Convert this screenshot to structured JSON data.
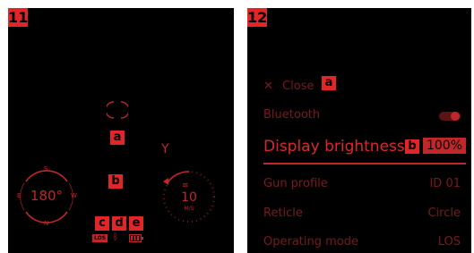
{
  "left_panel": {
    "number": "11",
    "label_a": "a",
    "label_b": "b",
    "label_c": "c",
    "label_d": "d",
    "label_e": "e",
    "y_marker": "Y",
    "compass": {
      "north": "N",
      "south": "S",
      "east": "E",
      "west": "W",
      "heading": "180°"
    },
    "wind": {
      "speed": "10",
      "unit": "M/S"
    },
    "status": {
      "mode": "LOS",
      "bluetooth_icon": "bluetooth-icon",
      "battery_icon": "battery-icon"
    }
  },
  "right_panel": {
    "number": "12",
    "close_label": "Close",
    "label_a": "a",
    "label_b": "b",
    "bluetooth_label": "Bluetooth",
    "brightness_label": "Display brightness",
    "brightness_value": "100%",
    "menu": [
      {
        "label": "Gun profile",
        "value": "ID 01"
      },
      {
        "label": "Reticle",
        "value": "Circle"
      },
      {
        "label": "Operating mode",
        "value": "LOS"
      }
    ]
  },
  "colors": {
    "accent": "#e1262a",
    "dim": "#7a1a1d",
    "background": "#000000"
  }
}
